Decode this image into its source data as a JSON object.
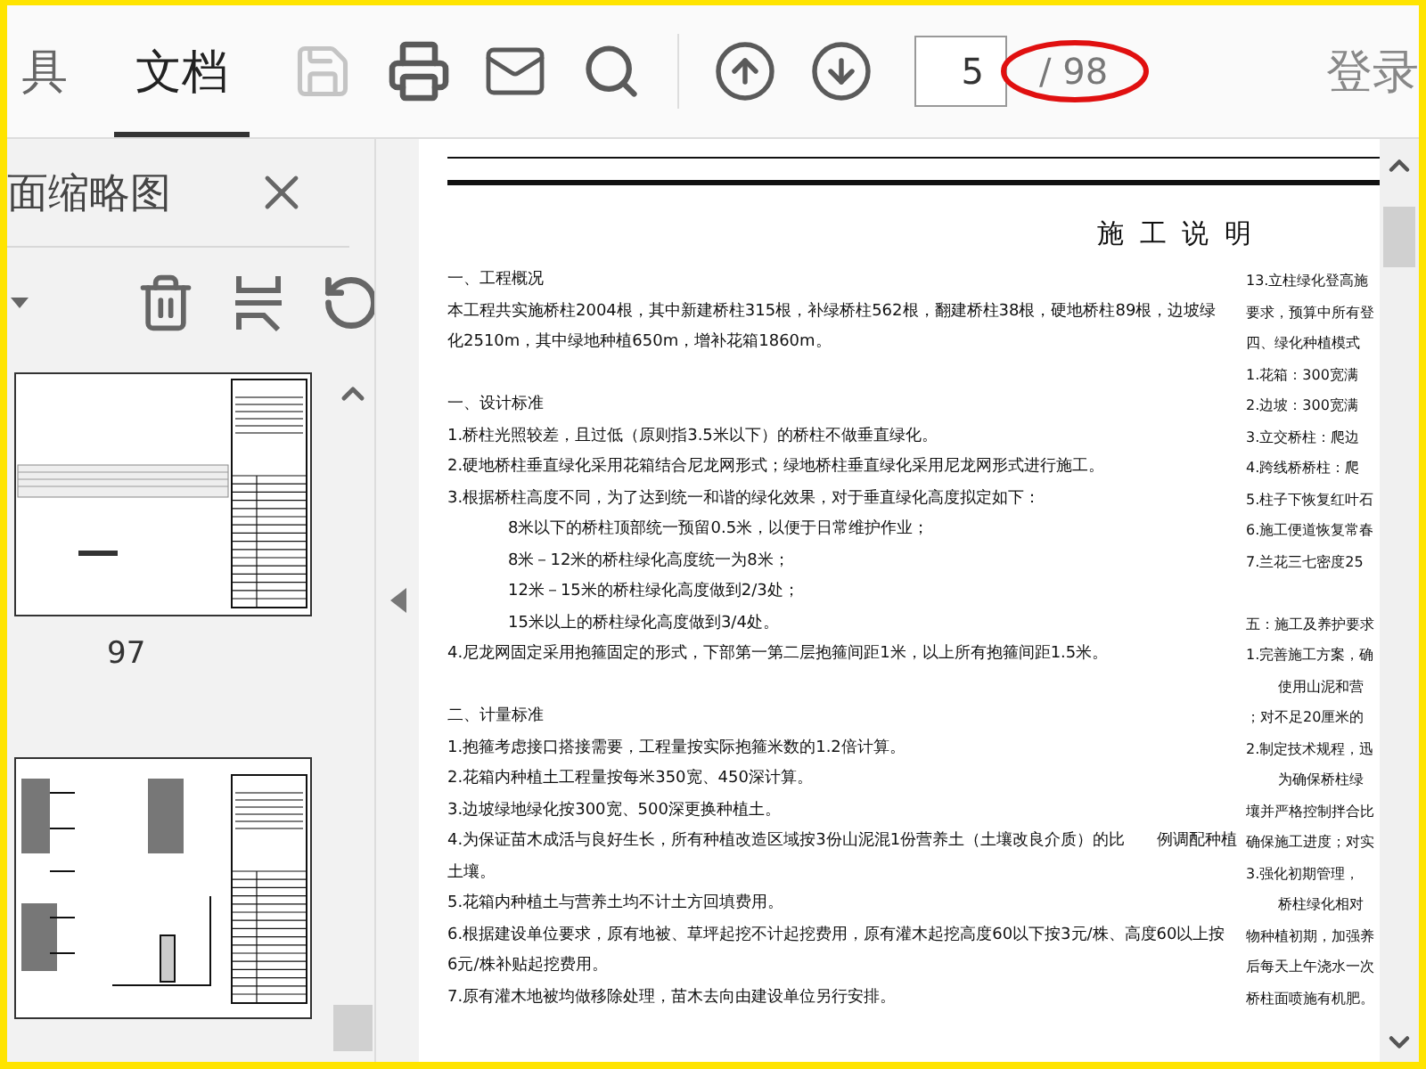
{
  "toolbar": {
    "tabs": [
      {
        "label": "具",
        "selected": false
      },
      {
        "label": "文档",
        "selected": true
      }
    ],
    "tools": [
      {
        "kind": "save",
        "disabled": true
      },
      {
        "kind": "print",
        "disabled": false
      },
      {
        "kind": "mail",
        "disabled": false
      },
      {
        "kind": "search",
        "disabled": false
      }
    ],
    "nav": [
      {
        "kind": "up"
      },
      {
        "kind": "down"
      }
    ],
    "page_input": {
      "value": "5"
    },
    "page_total": "/ 98",
    "sign_in": "登录"
  },
  "sidebar": {
    "title": "面缩略图",
    "tools": [
      {
        "kind": "dropdown"
      },
      {
        "kind": "delete"
      },
      {
        "kind": "split"
      },
      {
        "kind": "rotate"
      }
    ],
    "pages": [
      {
        "kind": "table-sheet",
        "label": "97"
      },
      {
        "kind": "detail-sheet"
      }
    ]
  },
  "document": {
    "title": "施 工 说 明",
    "columns": [
      [
        {
          "heading": "一、工程概况",
          "lines": [
            {
              "kind": "line",
              "text": "本工程共实施桥柱2004根，其中新建桥柱315根，补绿桥柱562根，翻建桥柱38根，硬地桥柱89根，边坡绿"
            },
            {
              "kind": "line",
              "text": "化2510m，其中绿地种植650m，增补花箱1860m。"
            }
          ]
        },
        {
          "heading": "一、设计标准",
          "lines": [
            {
              "kind": "line",
              "text": "1.桥柱光照较差，且过低（原则指3.5米以下）的桥柱不做垂直绿化。"
            },
            {
              "kind": "line",
              "text": "2.硬地桥柱垂直绿化采用花箱结合尼龙网形式；绿地桥柱垂直绿化采用尼龙网形式进行施工。"
            },
            {
              "kind": "line",
              "text": "3.根据桥柱高度不同，为了达到统一和谐的绿化效果，对于垂直绿化高度拟定如下："
            },
            {
              "kind": "indented",
              "text": "8米以下的桥柱顶部统一预留0.5米，以便于日常维护作业；"
            },
            {
              "kind": "indented",
              "text": "8米－12米的桥柱绿化高度统一为8米；"
            },
            {
              "kind": "indented",
              "text": "12米－15米的桥柱绿化高度做到2/3处；"
            },
            {
              "kind": "indented",
              "text": "15米以上的桥柱绿化高度做到3/4处。"
            },
            {
              "kind": "line",
              "text": "4.尼龙网固定采用抱箍固定的形式，下部第一第二层抱箍间距1米，以上所有抱箍间距1.5米。"
            }
          ]
        },
        {
          "heading": "二、计量标准",
          "lines": [
            {
              "kind": "line",
              "text": "1.抱箍考虑接口搭接需要，工程量按实际抱箍米数的1.2倍计算。"
            },
            {
              "kind": "line",
              "text": "2.花箱内种植土工程量按每米350宽、450深计算。"
            },
            {
              "kind": "line",
              "text": "3.边坡绿地绿化按300宽、500深更换种植土。"
            },
            {
              "kind": "line",
              "text": "4.为保证苗木成活与良好生长，所有种植改造区域按3份山泥混1份营养土（土壤改良介质）的比　　例调配种植"
            },
            {
              "kind": "line",
              "text": "土壤。"
            },
            {
              "kind": "line",
              "text": "5.花箱内种植土与营养土均不计土方回填费用。"
            },
            {
              "kind": "line",
              "text": "6.根据建设单位要求，原有地被、草坪起挖不计起挖费用，原有灌木起挖高度60以下按3元/株、高度60以上按"
            },
            {
              "kind": "line",
              "text": "6元/株补贴起挖费用。"
            },
            {
              "kind": "line",
              "text": "7.原有灌木地被均做移除处理，苗木去向由建设单位另行安排。"
            }
          ]
        }
      ],
      [
        {
          "lines": [
            {
              "kind": "line",
              "text": "13.立柱绿化登高施"
            },
            {
              "kind": "line",
              "text": "要求，预算中所有登"
            },
            {
              "kind": "line",
              "text": "四、绿化种植模式"
            },
            {
              "kind": "line",
              "text": "1.花箱：300宽满"
            },
            {
              "kind": "line",
              "text": "2.边坡：300宽满"
            },
            {
              "kind": "line",
              "text": "3.立交桥柱：爬边"
            },
            {
              "kind": "line",
              "text": "4.跨线桥桥柱：爬"
            },
            {
              "kind": "line",
              "text": "5.柱子下恢复红叶石"
            },
            {
              "kind": "line",
              "text": "6.施工便道恢复常春"
            },
            {
              "kind": "line",
              "text": "7.兰花三七密度25"
            }
          ]
        },
        {
          "lines": [
            {
              "kind": "line",
              "text": "五：施工及养护要求"
            },
            {
              "kind": "line",
              "text": "1.完善施工方案，确"
            },
            {
              "kind": "indented",
              "text": "使用山泥和营"
            },
            {
              "kind": "line",
              "text": "；对不足20厘米的"
            },
            {
              "kind": "line",
              "text": "2.制定技术规程，迅"
            },
            {
              "kind": "indented",
              "text": "为确保桥柱绿"
            },
            {
              "kind": "line",
              "text": "壤并严格控制拌合比"
            },
            {
              "kind": "line",
              "text": "确保施工进度；对实"
            },
            {
              "kind": "line",
              "text": "3.强化初期管理，"
            },
            {
              "kind": "indented",
              "text": "桥柱绿化相对"
            },
            {
              "kind": "line",
              "text": "物种植初期，加强养"
            },
            {
              "kind": "line",
              "text": "后每天上午浇水一次"
            },
            {
              "kind": "line",
              "text": "桥柱面喷施有机肥。"
            }
          ]
        }
      ]
    ]
  }
}
